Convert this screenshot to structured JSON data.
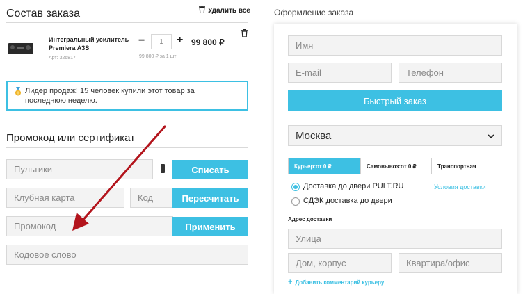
{
  "cart": {
    "title": "Состав заказа",
    "delete_all": "Удалить все",
    "item": {
      "name_line1": "Интегральный усилитель",
      "name_line2": "Premiera A3S",
      "sku": "Арт: 326817",
      "qty": "1",
      "minus": "−",
      "plus": "+",
      "price": "99 800 ₽",
      "unit_price": "99 800 ₽ за 1 шт"
    },
    "notice": "Лидер продаж! 15 человек купили этот товар за последнюю неделю."
  },
  "promo": {
    "title": "Промокод или сертификат",
    "pultiki_placeholder": "Пультики",
    "spend_label": "Списать",
    "club_card_placeholder": "Клубная карта",
    "code_placeholder": "Код",
    "recalc_label": "Пересчитать",
    "promo_placeholder": "Промокод",
    "apply_label": "Применить",
    "codeword_placeholder": "Кодовое слово"
  },
  "checkout": {
    "title": "Оформление заказа",
    "name_placeholder": "Имя",
    "email_placeholder": "E-mail",
    "phone_placeholder": "Телефон",
    "quick_order_label": "Быстрый заказ",
    "city": "Москва",
    "tabs": [
      {
        "label": "Курьер:от 0 ₽",
        "active": true
      },
      {
        "label": "Самовывоз:от 0 ₽",
        "active": false
      },
      {
        "label": "Транспортная",
        "active": false
      }
    ],
    "delivery_options": [
      {
        "label": "Доставка до двери PULT.RU",
        "selected": true
      },
      {
        "label": "СДЭК доставка до двери",
        "selected": false
      }
    ],
    "delivery_terms_link": "Условия доставки",
    "address_title": "Адрес доставки",
    "street_placeholder": "Улица",
    "house_placeholder": "Дом, корпус",
    "apartment_placeholder": "Квартира/офис",
    "add_comment_label": "Добавить комментарий курьеру"
  },
  "colors": {
    "accent": "#3dc0e3",
    "arrow": "#b3141c"
  }
}
